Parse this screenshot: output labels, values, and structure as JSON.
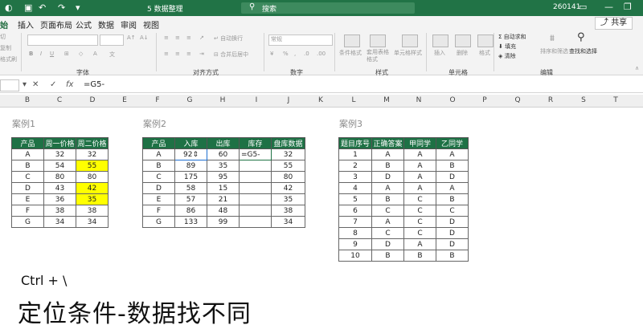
{
  "titlebar": {
    "autosave_icon": "autosave-icon",
    "save_icon": "save-icon",
    "undo_icon": "undo-icon",
    "redo_icon": "redo-icon",
    "title": "5 数据整理",
    "search_placeholder": "搜索",
    "user": "260141",
    "bg_color": "#217346"
  },
  "menu": {
    "items": [
      "始",
      "插入",
      "页面布局",
      "公式",
      "数据",
      "审阅",
      "视图"
    ],
    "active_index": 0,
    "share": "共享"
  },
  "ribbon": {
    "groups": [
      "字体",
      "对齐方式",
      "数字",
      "样式",
      "单元格",
      "编辑"
    ],
    "wrap_text": "自动换行",
    "merge_center": "合并后居中",
    "number_format": "常规",
    "conditional_format": "条件格式",
    "table_format": "套用表格格式",
    "cell_style": "单元格样式",
    "insert": "插入",
    "delete": "删除",
    "format": "格式",
    "autosum": "自动求和",
    "fill": "填充",
    "clear": "清除",
    "sort_filter": "排序和筛选",
    "find_select": "查找和选择",
    "clip_items": [
      "切",
      "复制",
      "格式刷"
    ]
  },
  "formula_bar": {
    "name_box": "",
    "formula": "=G5-"
  },
  "columns": [
    "B",
    "C",
    "D",
    "E",
    "F",
    "G",
    "H",
    "I",
    "J",
    "K",
    "L",
    "M",
    "N",
    "O",
    "P",
    "Q",
    "R",
    "S",
    "T"
  ],
  "case1": {
    "label": "案例1",
    "headers": [
      "产品",
      "周一价格",
      "周二价格"
    ],
    "rows": [
      [
        "A",
        "32",
        "32"
      ],
      [
        "B",
        "54",
        "55"
      ],
      [
        "C",
        "80",
        "80"
      ],
      [
        "D",
        "43",
        "42"
      ],
      [
        "E",
        "36",
        "35"
      ],
      [
        "F",
        "38",
        "38"
      ],
      [
        "G",
        "34",
        "34"
      ]
    ]
  },
  "case2": {
    "label": "案例2",
    "headers": [
      "产品",
      "入库",
      "出库",
      "库存",
      "盘库数据"
    ],
    "rows": [
      [
        "A",
        "92",
        "60",
        "=G5-",
        "32"
      ],
      [
        "B",
        "89",
        "35",
        "",
        "55"
      ],
      [
        "C",
        "175",
        "95",
        "",
        "80"
      ],
      [
        "D",
        "58",
        "15",
        "",
        "42"
      ],
      [
        "E",
        "57",
        "21",
        "",
        "35"
      ],
      [
        "F",
        "86",
        "48",
        "",
        "38"
      ],
      [
        "G",
        "133",
        "99",
        "",
        "34"
      ]
    ]
  },
  "case3": {
    "label": "案例3",
    "headers": [
      "题目序号",
      "正确答案",
      "甲同学",
      "乙同学"
    ],
    "rows": [
      [
        "1",
        "A",
        "A",
        "A"
      ],
      [
        "2",
        "B",
        "A",
        "B"
      ],
      [
        "3",
        "D",
        "A",
        "D"
      ],
      [
        "4",
        "A",
        "A",
        "A"
      ],
      [
        "5",
        "B",
        "C",
        "B"
      ],
      [
        "6",
        "C",
        "C",
        "C"
      ],
      [
        "7",
        "A",
        "C",
        "D"
      ],
      [
        "8",
        "C",
        "C",
        "D"
      ],
      [
        "9",
        "D",
        "A",
        "D"
      ],
      [
        "10",
        "B",
        "B",
        "B"
      ]
    ]
  },
  "shortcut": "Ctrl + \\",
  "caption": "定位条件-数据找不同"
}
